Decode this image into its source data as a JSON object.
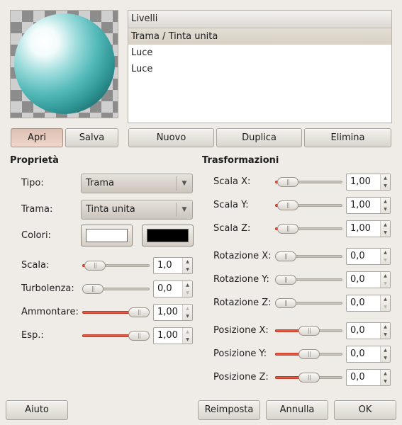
{
  "layers": {
    "header": "Livelli",
    "items": [
      "Trama / Tinta unita",
      "Luce",
      "Luce"
    ],
    "selected_index": 0
  },
  "buttons": {
    "open": "Apri",
    "save": "Salva",
    "new": "Nuovo",
    "duplicate": "Duplica",
    "delete": "Elimina",
    "help": "Aiuto",
    "reset": "Reimposta",
    "cancel": "Annulla",
    "ok": "OK"
  },
  "properties": {
    "heading": "Proprietà",
    "type_label": "Tipo:",
    "type_value": "Trama",
    "texture_label": "Trama:",
    "texture_value": "Tinta unita",
    "colors_label": "Colori:",
    "color1": "#ffffff",
    "color2": "#000000",
    "scale_label": "Scala:",
    "scale_value": "1,0",
    "scale_level": 0.05,
    "turbulence_label": "Turbolenza:",
    "turbulence_value": "0,0",
    "turbulence_level": 0.0,
    "amount_label": "Ammontare:",
    "amount_value": "1,00",
    "amount_level": 1.0,
    "exp_label": "Esp.:",
    "exp_value": "1,00",
    "exp_level": 1.0
  },
  "transforms": {
    "heading": "Trasformazioni",
    "scale_x_label": "Scala X:",
    "scale_x_value": "1,00",
    "scale_x_level": 0.04,
    "scale_y_label": "Scala Y:",
    "scale_y_value": "1,00",
    "scale_y_level": 0.04,
    "scale_z_label": "Scala Z:",
    "scale_z_value": "1,00",
    "scale_z_level": 0.04,
    "rot_x_label": "Rotazione X:",
    "rot_x_value": "0,0",
    "rot_x_level": 0.0,
    "rot_y_label": "Rotazione Y:",
    "rot_y_value": "0,0",
    "rot_y_level": 0.0,
    "rot_z_label": "Rotazione Z:",
    "rot_z_value": "0,0",
    "rot_z_level": 0.0,
    "pos_x_label": "Posizione X:",
    "pos_x_value": "0,0",
    "pos_x_level": 0.5,
    "pos_y_label": "Posizione Y:",
    "pos_y_value": "0,0",
    "pos_y_level": 0.5,
    "pos_z_label": "Posizione Z:",
    "pos_z_value": "0,0",
    "pos_z_level": 0.5
  },
  "colors": {
    "slider_fill": "#e05a45",
    "sphere": "#54b9b9"
  }
}
